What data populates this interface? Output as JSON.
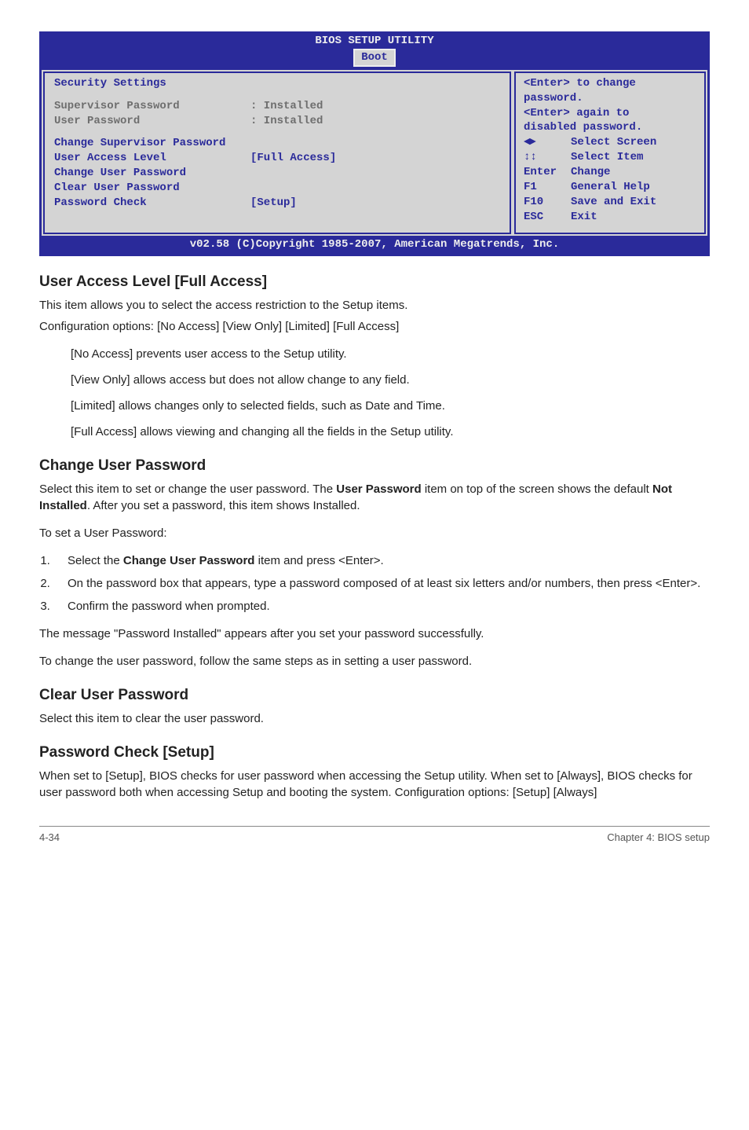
{
  "bios": {
    "title": "BIOS SETUP UTILITY",
    "tab_active": "Boot",
    "section_heading": "Security Settings",
    "status": {
      "supervisor_label": "Supervisor Password",
      "supervisor_value": ": Installed",
      "user_label": "User Password",
      "user_value": ": Installed"
    },
    "items": {
      "change_supervisor": "Change Supervisor Password",
      "user_access_level_label": "User Access Level",
      "user_access_level_value": "[Full Access]",
      "change_user": "Change User Password",
      "clear_user": "Clear User Password",
      "password_check_label": "Password Check",
      "password_check_value": "[Setup]"
    },
    "help": {
      "line1": "<Enter> to change",
      "line2": "password.",
      "line3": "<Enter> again to",
      "line4": "disabled password."
    },
    "nav": {
      "select_screen": "Select Screen",
      "select_item": "Select Item",
      "enter_k": "Enter",
      "enter_v": "Change",
      "f1_k": "F1",
      "f1_v": "General Help",
      "f10_k": "F10",
      "f10_v": "Save and Exit",
      "esc_k": "ESC",
      "esc_v": "Exit"
    },
    "footer": "v02.58 (C)Copyright 1985-2007, American Megatrends, Inc."
  },
  "doc": {
    "h_user_access": "User Access Level [Full Access]",
    "p_user_access_1": "This item allows you to select the access restriction to the Setup items.",
    "p_user_access_2": "Configuration options: [No Access] [View Only] [Limited] [Full Access]",
    "opt_no_access": "[No Access] prevents user access to the Setup utility.",
    "opt_view_only": "[View Only] allows access but does not allow change to any field.",
    "opt_limited": "[Limited] allows changes only to selected fields, such as Date and Time.",
    "opt_full": "[Full Access] allows viewing and changing all the fields in the Setup utility.",
    "h_change_user": "Change User Password",
    "p_change_user_pre": "Select this item to set or change the user password. The ",
    "p_change_user_bold1": "User Password",
    "p_change_user_mid": " item on top of the screen shows the default ",
    "p_change_user_bold2": "Not Installed",
    "p_change_user_post": ". After you set a password, this item shows Installed.",
    "p_to_set": "To set a User Password:",
    "step1_pre": "Select the ",
    "step1_bold": "Change User Password",
    "step1_post": " item and press <Enter>.",
    "step2": "On the password box that appears, type a password composed of at least six letters and/or numbers, then press <Enter>.",
    "step3": "Confirm the password when prompted.",
    "p_installed_msg": "The message \"Password Installed\" appears after you set your password successfully.",
    "p_change_follow": "To change the user password, follow the same steps as in setting a user password.",
    "h_clear_user": "Clear User Password",
    "p_clear_user": "Select this item to clear the user password.",
    "h_pw_check": "Password Check [Setup]",
    "p_pw_check": "When set to [Setup], BIOS checks for user password when accessing the Setup utility. When set to [Always], BIOS checks for user password both when accessing Setup and booting the system. Configuration options: [Setup] [Always]",
    "footer_left": "4-34",
    "footer_right": "Chapter 4: BIOS setup"
  }
}
